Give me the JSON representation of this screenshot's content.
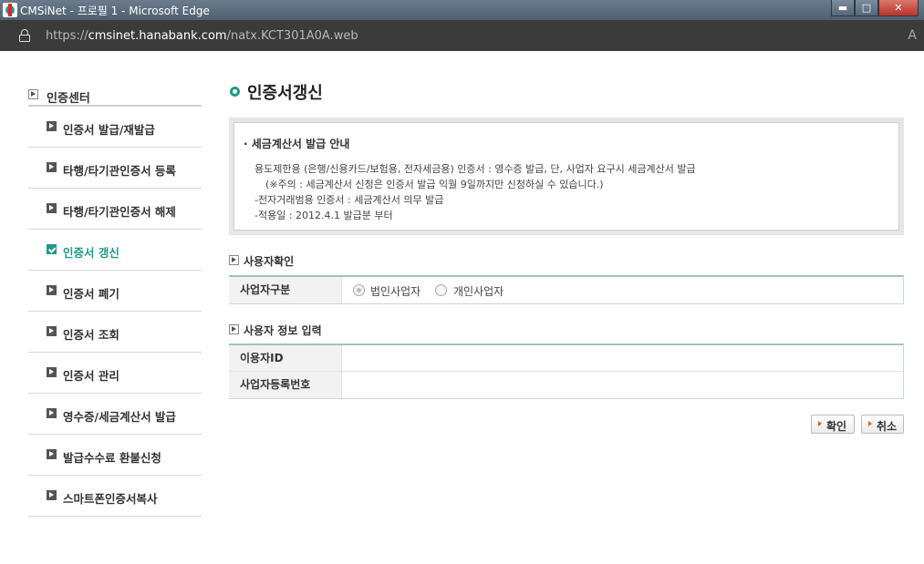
{
  "window": {
    "title": "CMSiNet - 프로필 1 - Microsoft Edge",
    "url_prefix": "https://",
    "url_host": "cmsinet.hanabank.com",
    "url_path": "/natx.KCT301A0A.web",
    "min_label": "▬",
    "max_label": "□",
    "close_label": "✕",
    "reader_label": "A"
  },
  "sidebar": {
    "heading": "인증센터",
    "items": [
      {
        "label": "인증서 발급/재발급"
      },
      {
        "label": "타행/타기관인증서 등록"
      },
      {
        "label": "타행/타기관인증서 해제"
      },
      {
        "label": "인증서 갱신",
        "active": true
      },
      {
        "label": "인증서 폐기"
      },
      {
        "label": "인증서 조회"
      },
      {
        "label": "인증서 관리"
      },
      {
        "label": "영수증/세금계산서 발급"
      },
      {
        "label": "발급수수료 환불신청"
      },
      {
        "label": "스마트폰인증서복사"
      }
    ]
  },
  "main": {
    "title": "인증서갱신",
    "notice": {
      "title": "· 세금계산서 발급 안내",
      "lines": [
        "용도제한용 (은행/신용카드/보험용, 전자세금용) 인증서 : 영수증 발급, 단, 사업자 요구시 세금계산서 발급",
        "(※주의 : 세금계산서 신청은 인증서 발급 익월 9일까지만 신청하실 수 있습니다.)",
        "-전자거래범용 인증서 : 세금계산서 의무 발급",
        "-적용일 : 2012.4.1 발급분 부터"
      ]
    },
    "user_check": {
      "heading": "사용자확인",
      "business_type_label": "사업자구분",
      "option_corporate": "법인사업자",
      "option_individual": "개인사업자"
    },
    "user_info": {
      "heading": "사용자 정보 입력",
      "user_id_label": "이용자ID",
      "user_id_value": "",
      "business_reg_label": "사업자등록번호",
      "business_reg_value": ""
    },
    "buttons": {
      "confirm": "확인",
      "cancel": "취소"
    }
  },
  "colors": {
    "accent": "#1f9a8a",
    "button_arrow": "#d9631e"
  }
}
